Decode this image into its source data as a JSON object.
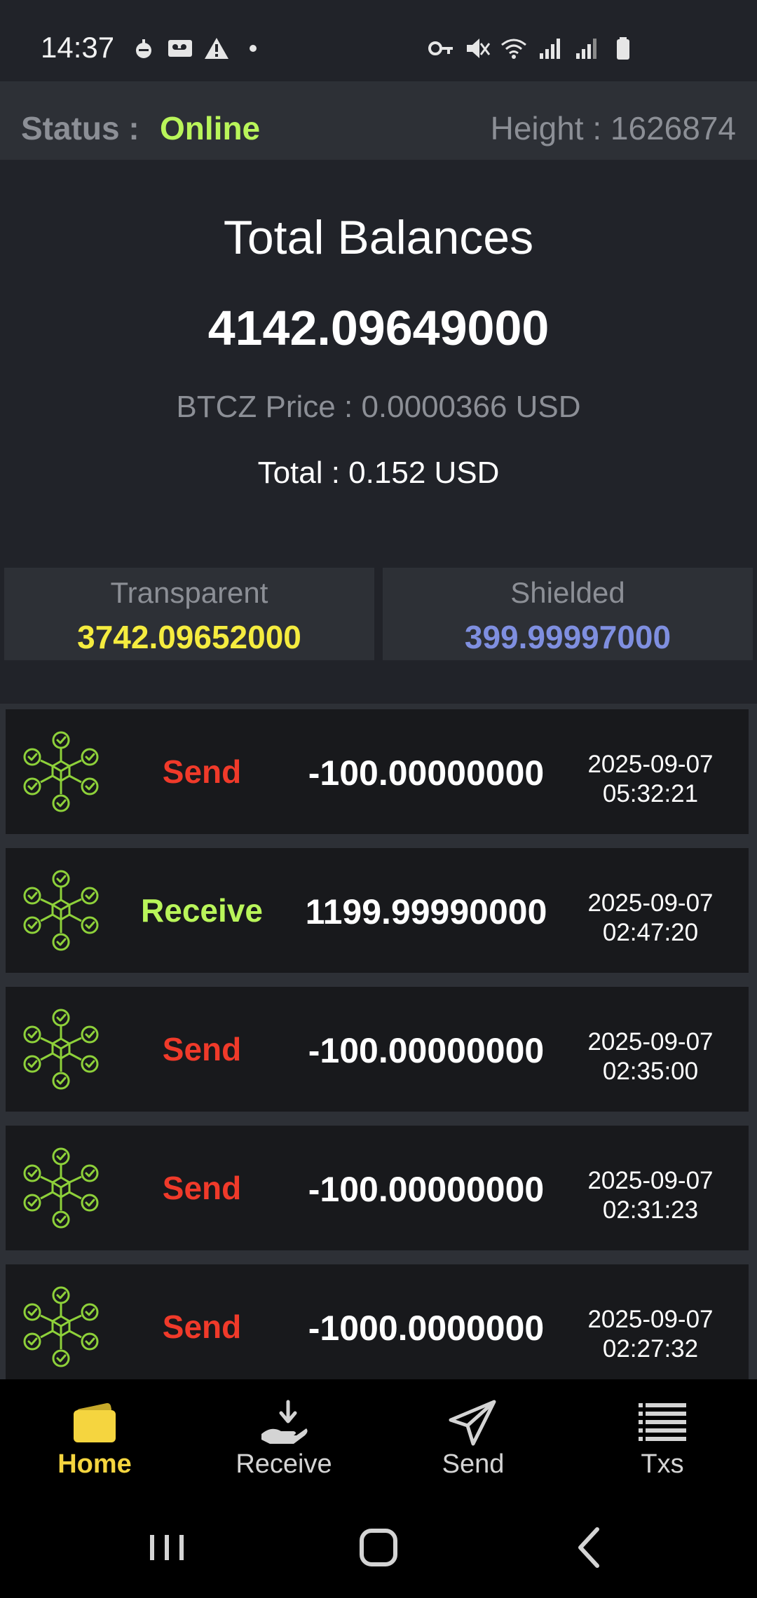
{
  "status_bar": {
    "time": "14:37",
    "left_icons": [
      "app-notification-icon",
      "voicemail-icon",
      "warning-icon",
      "dot-icon"
    ],
    "right_icons": [
      "vpn-key-icon",
      "mute-icon",
      "wifi-icon",
      "signal-icon",
      "signal-icon",
      "battery-icon"
    ]
  },
  "info": {
    "status_label": "Status :",
    "status_value": "Online",
    "status_color": "#b9f55a",
    "height_label": "Height : 1626874"
  },
  "summary": {
    "title": "Total Balances",
    "amount": "4142.09649000",
    "price": "BTCZ Price : 0.0000366 USD",
    "total_usd": "Total : 0.152 USD"
  },
  "balances": {
    "transparent_label": "Transparent",
    "transparent_value": "3742.09652000",
    "transparent_color": "#f5ec3f",
    "shielded_label": "Shielded",
    "shielded_value": "399.99997000",
    "shielded_color": "#7f8fe0"
  },
  "transactions": [
    {
      "type": "Send",
      "amount": "-100.00000000",
      "date": "2025-09-07",
      "time": "05:32:21"
    },
    {
      "type": "Receive",
      "amount": "1199.99990000",
      "date": "2025-09-07",
      "time": "02:47:20"
    },
    {
      "type": "Send",
      "amount": "-100.00000000",
      "date": "2025-09-07",
      "time": "02:35:00"
    },
    {
      "type": "Send",
      "amount": "-100.00000000",
      "date": "2025-09-07",
      "time": "02:31:23"
    },
    {
      "type": "Send",
      "amount": "-1000.0000000",
      "date": "2025-09-07",
      "time": "02:27:32"
    }
  ],
  "colors": {
    "send": "#f03a2a",
    "receive": "#b9f55a",
    "accent": "#f5d53f",
    "icon_green": "#8ed13a"
  },
  "nav": {
    "items": [
      {
        "label": "Home",
        "icon": "wallet-icon",
        "active": true
      },
      {
        "label": "Receive",
        "icon": "receive-icon",
        "active": false
      },
      {
        "label": "Send",
        "icon": "send-icon",
        "active": false
      },
      {
        "label": "Txs",
        "icon": "list-icon",
        "active": false
      }
    ]
  },
  "system_nav": [
    "recent-apps-icon",
    "home-icon",
    "back-icon"
  ]
}
